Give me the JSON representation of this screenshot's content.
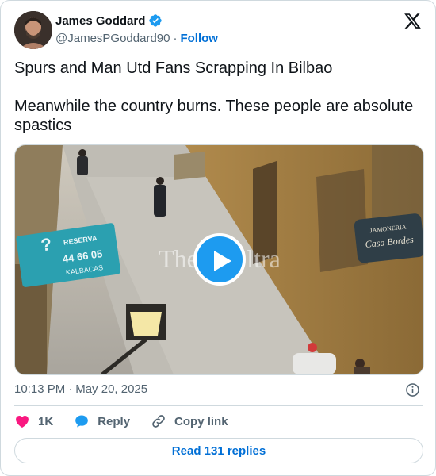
{
  "author": {
    "name": "James Goddard",
    "handle": "@JamesPGoddard90",
    "separator": "·",
    "follow_label": "Follow"
  },
  "tweet": {
    "line1": "Spurs and Man Utd Fans Scrapping In Bilbao",
    "line2": "Meanwhile the country burns. These people are absolute spastics"
  },
  "media": {
    "watermark": "TheC      lUltra",
    "sign_left": "☎ RESERVA · 44 66 05 · KALBACAS",
    "sign_right": "JAMÓNERÍA Casa Bordes"
  },
  "meta": {
    "time": "10:13 PM",
    "separator": "·",
    "date": "May 20, 2025"
  },
  "actions": {
    "likes": "1K",
    "reply_label": "Reply",
    "copy_label": "Copy link"
  },
  "read_replies_label": "Read 131 replies",
  "colors": {
    "accent": "#1d9bf0",
    "link": "#006fd6",
    "like": "#f91880",
    "muted": "#536471"
  },
  "icons": [
    "verified-badge-icon",
    "x-logo-icon",
    "play-icon",
    "info-icon",
    "heart-icon",
    "reply-bubble-icon",
    "link-icon"
  ]
}
